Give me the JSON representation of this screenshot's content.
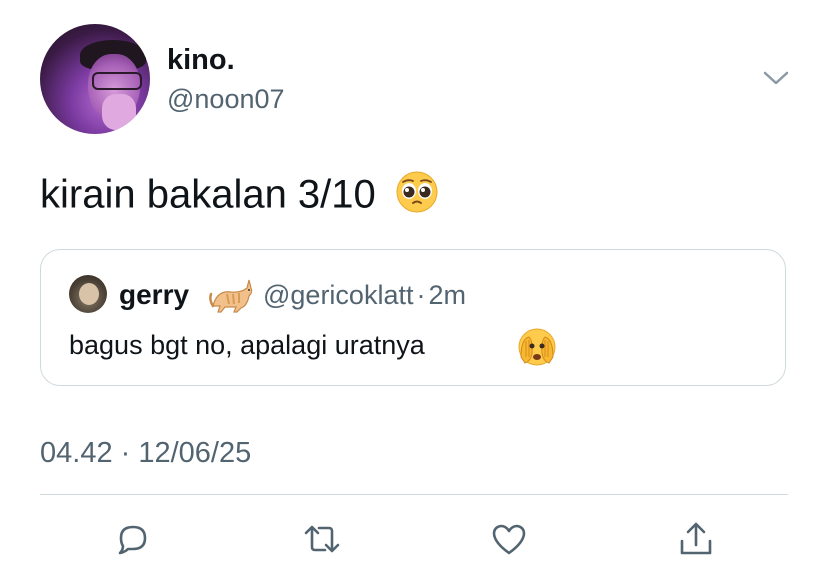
{
  "author": {
    "display_name": "kino.",
    "handle": "@noon07",
    "avatar": "profile-photo"
  },
  "tweet": {
    "text": "kirain bakalan 3/10",
    "emoji": "pleading-face"
  },
  "quoted_tweet": {
    "display_name": "gerry",
    "name_emoji": "cat",
    "handle": "@gericoklatt",
    "separator": "·",
    "time": "2m",
    "text": "bagus bgt no, apalagi uratnya",
    "emoji": "face-with-peeking-eye"
  },
  "timestamp": "04.42 · 12/06/25",
  "actions": [
    "reply-icon",
    "retweet-icon",
    "like-icon",
    "share-icon"
  ],
  "colors": {
    "text": "#0f1419",
    "secondary": "#536471",
    "border": "#cfd9de"
  }
}
